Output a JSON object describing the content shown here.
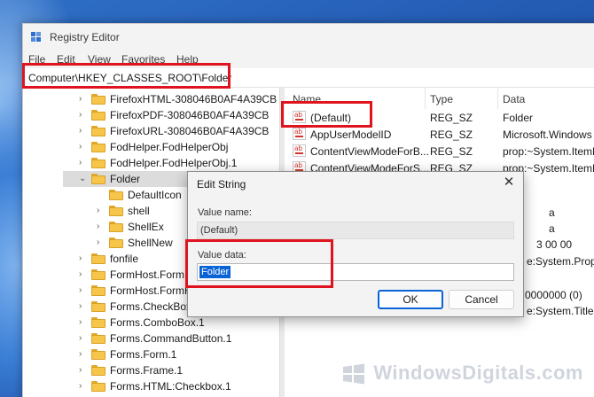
{
  "window": {
    "title": "Registry Editor",
    "menu": [
      "File",
      "Edit",
      "View",
      "Favorites",
      "Help"
    ],
    "address": "Computer\\HKEY_CLASSES_ROOT\\Folder"
  },
  "tree": {
    "items": [
      {
        "label": "FirefoxHTML-308046B0AF4A39CB",
        "expand": "›"
      },
      {
        "label": "FirefoxPDF-308046B0AF4A39CB",
        "expand": "›"
      },
      {
        "label": "FirefoxURL-308046B0AF4A39CB",
        "expand": "›"
      },
      {
        "label": "FodHelper.FodHelperObj",
        "expand": "›"
      },
      {
        "label": "FodHelper.FodHelperObj.1",
        "expand": "›"
      },
      {
        "label": "Folder",
        "expand": "⌄"
      },
      {
        "label": "DefaultIcon",
        "expand": ""
      },
      {
        "label": "shell",
        "expand": "›"
      },
      {
        "label": "ShellEx",
        "expand": "›"
      },
      {
        "label": "ShellNew",
        "expand": "›"
      },
      {
        "label": "fonfile",
        "expand": "›"
      },
      {
        "label": "FormHost.FormHost",
        "expand": "›"
      },
      {
        "label": "FormHost.FormHost",
        "expand": "›"
      },
      {
        "label": "Forms.CheckBox.1",
        "expand": "›"
      },
      {
        "label": "Forms.ComboBox.1",
        "expand": "›"
      },
      {
        "label": "Forms.CommandButton.1",
        "expand": "›"
      },
      {
        "label": "Forms.Form.1",
        "expand": "›"
      },
      {
        "label": "Forms.Frame.1",
        "expand": "›"
      },
      {
        "label": "Forms.HTML:Checkbox.1",
        "expand": "›"
      }
    ]
  },
  "values": {
    "columns": [
      "Name",
      "Type",
      "Data"
    ],
    "rows": [
      {
        "name": "(Default)",
        "type": "REG_SZ",
        "data": "Folder"
      },
      {
        "name": "AppUserModelID",
        "type": "REG_SZ",
        "data": "Microsoft.Windows"
      },
      {
        "name": "ContentViewModeForB...",
        "type": "REG_SZ",
        "data": "prop:~System.ItemN"
      },
      {
        "name": "ContentViewModeForS...",
        "type": "REG_SZ",
        "data": "prop:~System.ItemN"
      }
    ],
    "peek": [
      "a",
      "a",
      "3 00 00",
      "e:System.PropG",
      "0000000 (0)",
      "e:System.Title"
    ]
  },
  "dialog": {
    "title": "Edit String",
    "close_glyph": "✕",
    "value_name_label": "Value name:",
    "value_name": "(Default)",
    "value_data_label": "Value data:",
    "value_data": "Folder",
    "ok": "OK",
    "cancel": "Cancel"
  },
  "watermark": "WindowsDigitals.com",
  "colors": {
    "highlight": "#e0141e",
    "selection": "#0a64d6",
    "folder": "#f6c64a"
  }
}
